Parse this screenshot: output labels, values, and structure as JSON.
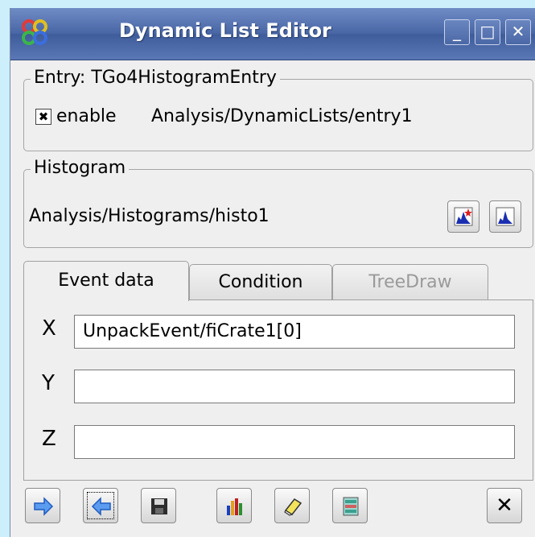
{
  "window": {
    "title": "Dynamic List Editor",
    "controls": {
      "minimize": "_",
      "maximize": "□",
      "close": "✕"
    }
  },
  "entry": {
    "group_title": "Entry: TGo4HistogramEntry",
    "checkbox_checked": true,
    "checkbox_mark": "✖",
    "enable_label": "enable",
    "path": "Analysis/DynamicLists/entry1"
  },
  "histogram": {
    "group_title": "Histogram",
    "path": "Analysis/Histograms/histo1"
  },
  "tabs": [
    {
      "label": "Event data",
      "state": "active"
    },
    {
      "label": "Condition",
      "state": "normal"
    },
    {
      "label": "TreeDraw",
      "state": "disabled"
    }
  ],
  "event_data": {
    "x_label": "X",
    "x_value": "UnpackEvent/fiCrate1[0]",
    "y_label": "Y",
    "y_value": "",
    "z_label": "Z",
    "z_value": ""
  },
  "toolbar": {
    "close_glyph": "✕"
  },
  "icons": [
    "app-gear-icon",
    "new-histogram-icon",
    "show-histogram-icon",
    "arrow-right-icon",
    "arrow-left-icon",
    "save-icon",
    "histogram-bars-icon",
    "eraser-icon",
    "list-clear-icon",
    "close-icon"
  ],
  "colors": {
    "titlebar": "#4a67a6",
    "background": "#cdeefb",
    "panel": "#efefef",
    "arrow_blue": "#3f7fe0"
  }
}
